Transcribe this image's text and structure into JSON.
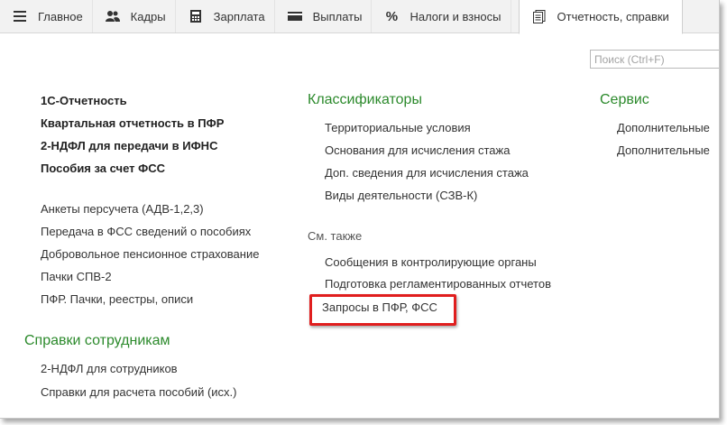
{
  "tabs": [
    {
      "label": "Главное",
      "icon": "menu-icon"
    },
    {
      "label": "Кадры",
      "icon": "people-icon"
    },
    {
      "label": "Зарплата",
      "icon": "calculator-icon"
    },
    {
      "label": "Выплаты",
      "icon": "wallet-icon"
    },
    {
      "label": "Налоги и взносы",
      "icon": "percent-icon"
    },
    {
      "label": "Отчетность, справки",
      "icon": "documents-icon",
      "active": true
    }
  ],
  "search": {
    "placeholder": "Поиск (Ctrl+F)"
  },
  "left": {
    "bold_items": [
      "1С-Отчетность",
      "Квартальная отчетность в ПФР",
      "2-НДФЛ для передачи в ИФНС",
      "Пособия за счет ФСС"
    ],
    "items": [
      "Анкеты персучета (АДВ-1,2,3)",
      "Передача в ФСС сведений о пособиях",
      "Добровольное пенсионное страхование",
      "Пачки СПВ-2",
      "ПФР. Пачки, реестры, описи"
    ],
    "section_title": "Справки сотрудникам",
    "section_items": [
      "2-НДФЛ для сотрудников",
      "Справки для расчета пособий (исх.)"
    ]
  },
  "middle": {
    "section_title": "Классификаторы",
    "items": [
      "Территориальные условия",
      "Основания для исчисления стажа",
      "Доп. сведения для исчисления стажа",
      "Виды деятельности (СЗВ-К)"
    ],
    "see_also_label": "См. также",
    "see_also_items": [
      "Сообщения в контролирующие органы",
      "Подготовка регламентированных отчетов",
      "Запросы в ПФР, ФСС"
    ]
  },
  "right": {
    "section_title": "Сервис",
    "items": [
      "Дополнительные",
      "Дополнительные"
    ]
  },
  "colors": {
    "accent_green": "#2c8a2c",
    "highlight_red": "#e01e1e"
  }
}
